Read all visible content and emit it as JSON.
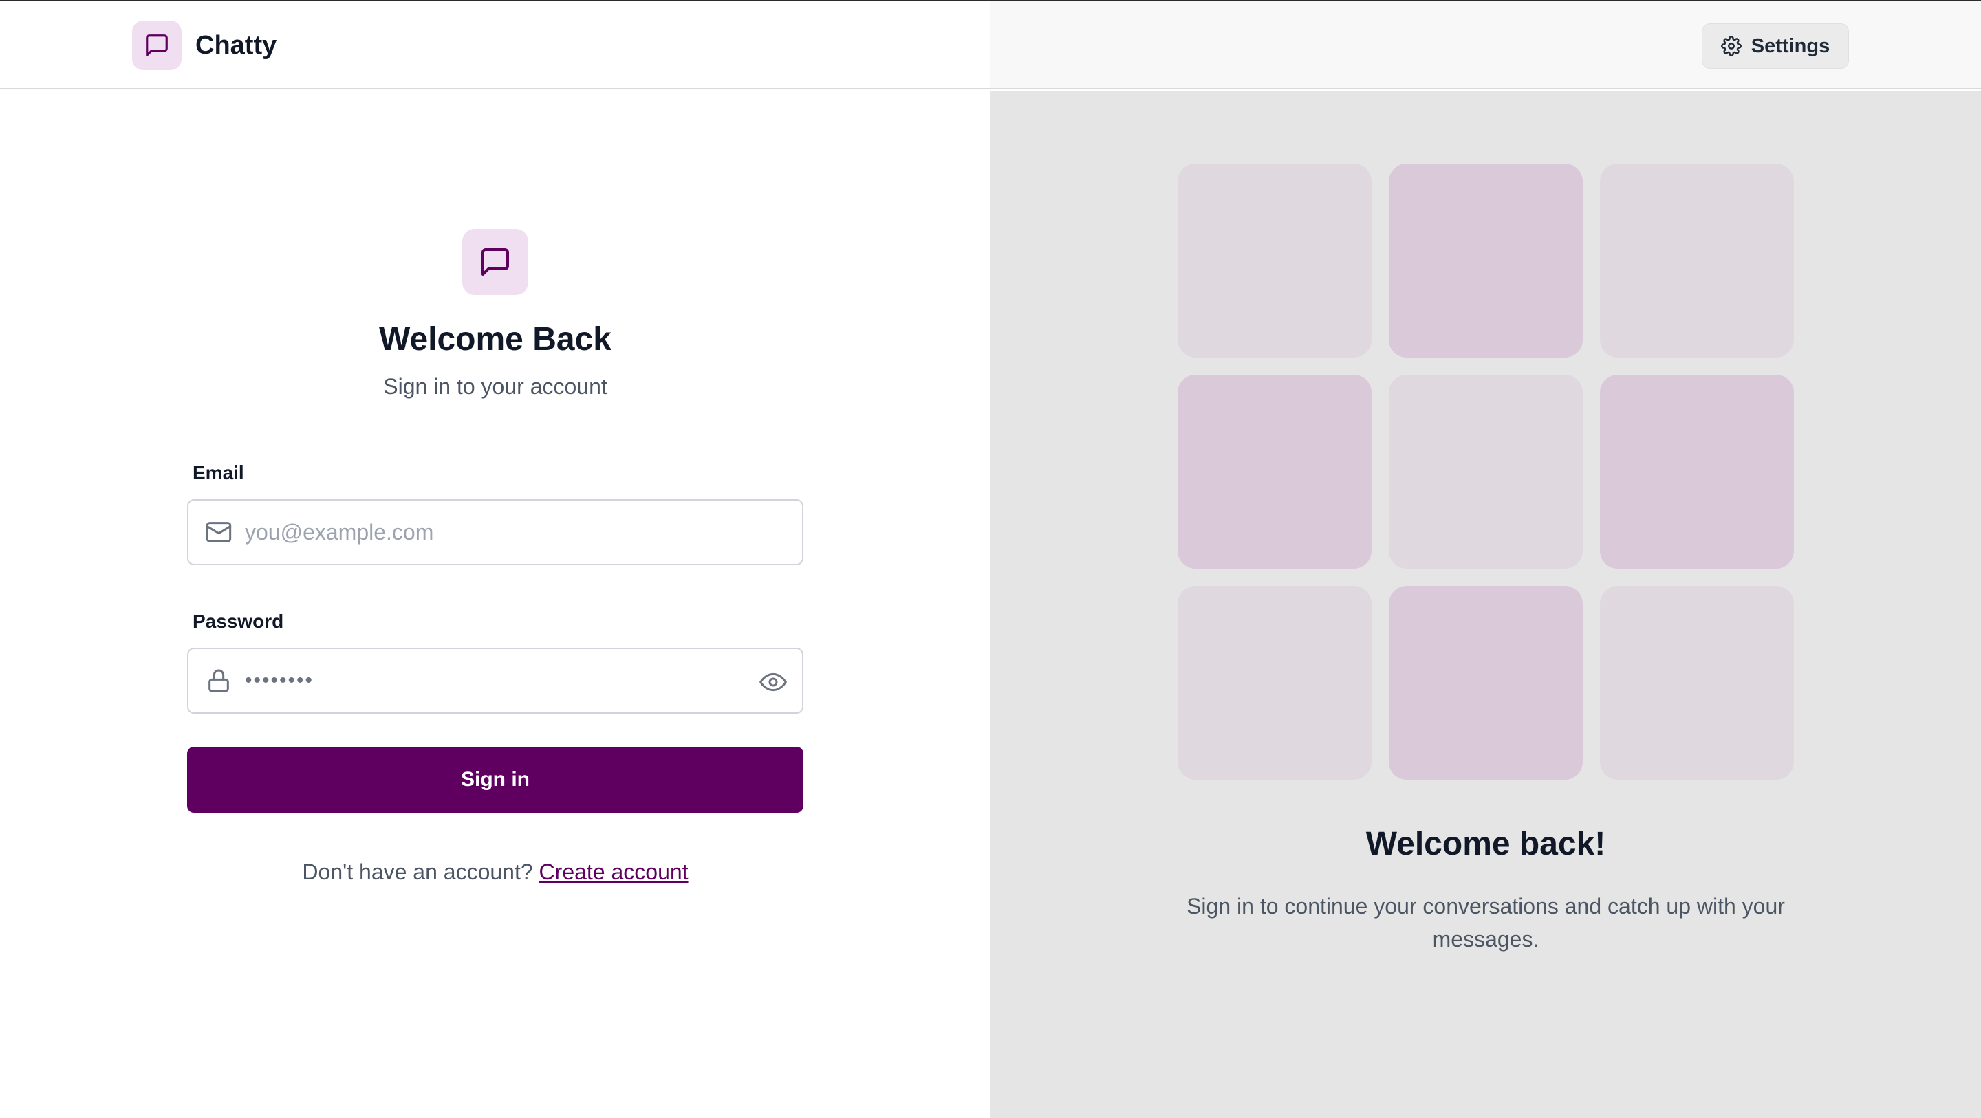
{
  "header": {
    "brand_name": "Chatty",
    "brand_icon": "message-square-icon",
    "settings_label": "Settings",
    "settings_icon": "gear-icon"
  },
  "login": {
    "icon": "message-square-icon",
    "title": "Welcome Back",
    "subtitle": "Sign in to your account",
    "email": {
      "label": "Email",
      "placeholder": "you@example.com",
      "value": "",
      "icon": "mail-icon"
    },
    "password": {
      "label": "Password",
      "placeholder": "••••••••",
      "value": "",
      "icon": "lock-icon",
      "toggle_icon": "eye-icon"
    },
    "submit_label": "Sign in",
    "signup_prompt": "Don't have an account?",
    "signup_link": "Create account"
  },
  "promo": {
    "tiles": [
      "light",
      "pink",
      "light",
      "pink",
      "light",
      "pink",
      "light",
      "pink",
      "light"
    ],
    "title": "Welcome back!",
    "text": "Sign in to continue your conversations and catch up with your messages."
  },
  "colors": {
    "accent": "#5f0061",
    "accent_soft": "#f0dff0",
    "tile_light": "#dfd9df",
    "tile_pink": "#d9c9d9",
    "right_panel_bg": "#e5e5e5"
  }
}
